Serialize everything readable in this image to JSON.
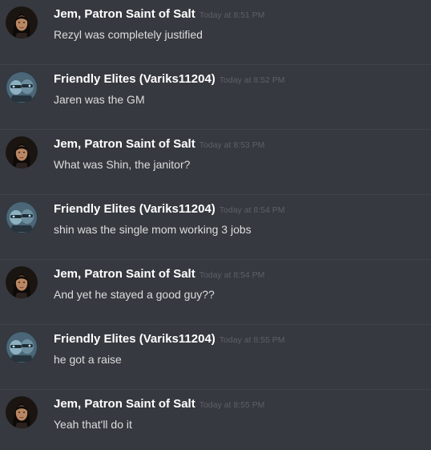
{
  "messages": [
    {
      "author": "Jem, Patron Saint of Salt",
      "avatar": "jem-avatar",
      "time": "Today at 8:51 PM",
      "text": "Rezyl was completely justified"
    },
    {
      "author": "Friendly Elites (Variks11204)",
      "avatar": "elites-avatar",
      "time": "Today at 8:52 PM",
      "text": "Jaren was the GM"
    },
    {
      "author": "Jem, Patron Saint of Salt",
      "avatar": "jem-avatar",
      "time": "Today at 8:53 PM",
      "text": "What was Shin, the janitor?"
    },
    {
      "author": "Friendly Elites (Variks11204)",
      "avatar": "elites-avatar",
      "time": "Today at 8:54 PM",
      "text": "shin was the single mom working 3 jobs"
    },
    {
      "author": "Jem, Patron Saint of Salt",
      "avatar": "jem-avatar",
      "time": "Today at 8:54 PM",
      "text": "And yet he stayed a good guy??"
    },
    {
      "author": "Friendly Elites (Variks11204)",
      "avatar": "elites-avatar",
      "time": "Today at 8:55 PM",
      "text": "he got a raise"
    },
    {
      "author": "Jem, Patron Saint of Salt",
      "avatar": "jem-avatar",
      "time": "Today at 8:55 PM",
      "text": "Yeah that'll do it"
    }
  ],
  "colors": {
    "background": "#36393f",
    "username": "#ffffff",
    "message_text": "#dcddde",
    "timestamp": "#5d6068",
    "divider": "#40434a"
  }
}
